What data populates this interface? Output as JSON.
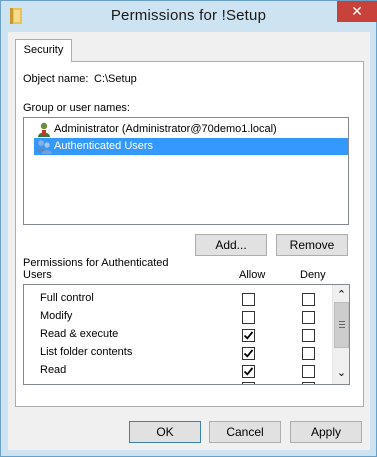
{
  "window": {
    "title": "Permissions for !Setup",
    "close_glyph": "✕",
    "icon": "folder-icon"
  },
  "tabs": [
    {
      "label": "Security"
    }
  ],
  "object": {
    "label": "Object name:",
    "value": "C:\\Setup"
  },
  "groups": {
    "label": "Group or user names:",
    "items": [
      {
        "label": "Administrator (Administrator@70demo1.local)",
        "icon": "user-icon",
        "selected": false
      },
      {
        "label": "Authenticated Users",
        "icon": "users-group-icon",
        "selected": true
      }
    ]
  },
  "buttons": {
    "add": "Add...",
    "remove": "Remove",
    "ok": "OK",
    "cancel": "Cancel",
    "apply": "Apply"
  },
  "permissions": {
    "title_line1": "Permissions for Authenticated",
    "title_line2": "Users",
    "allow_header": "Allow",
    "deny_header": "Deny",
    "rows": [
      {
        "label": "Full control",
        "allow": false,
        "deny": false
      },
      {
        "label": "Modify",
        "allow": false,
        "deny": false
      },
      {
        "label": "Read & execute",
        "allow": true,
        "deny": false
      },
      {
        "label": "List folder contents",
        "allow": true,
        "deny": false
      },
      {
        "label": "Read",
        "allow": true,
        "deny": false
      }
    ]
  },
  "scroll": {
    "up_glyph": "⌃",
    "down_glyph": "⌄"
  },
  "colors": {
    "title_bg": "#cde3f1",
    "close_bg": "#c8423b",
    "selection": "#3399ff"
  }
}
